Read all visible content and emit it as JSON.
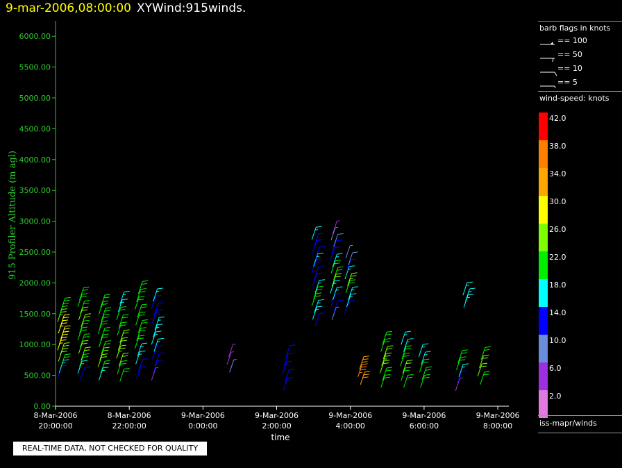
{
  "header": {
    "timestamp": "9-mar-2006,08:00:00",
    "title": "XYWind:915winds."
  },
  "quality_note": "REAL-TIME DATA, NOT CHECKED FOR QUALITY",
  "legend": {
    "barb_title": "barb flags in knots",
    "barb_flags": [
      {
        "kind": "pennant",
        "label": "== 100"
      },
      {
        "kind": "pennant-small",
        "label": "== 50"
      },
      {
        "kind": "full",
        "label": "== 10"
      },
      {
        "kind": "half",
        "label": "== 5"
      }
    ],
    "speed_title": "wind-speed: knots",
    "colorbar": [
      {
        "label": "42.0",
        "color": "#ff0000"
      },
      {
        "label": "38.0",
        "color": "#ff7f00"
      },
      {
        "label": "34.0",
        "color": "#ffa500"
      },
      {
        "label": "30.0",
        "color": "#ffff00"
      },
      {
        "label": "26.0",
        "color": "#7fff00"
      },
      {
        "label": "22.0",
        "color": "#00ee00"
      },
      {
        "label": "18.0",
        "color": "#00ffff"
      },
      {
        "label": "14.0",
        "color": "#0000ff"
      },
      {
        "label": "10.0",
        "color": "#6a8ddb"
      },
      {
        "label": "6.0",
        "color": "#9b30e0"
      },
      {
        "label": "2.0",
        "color": "#e07ae0"
      }
    ],
    "source": "iss-mapr/winds"
  },
  "chart_data": {
    "type": "scatter",
    "title": "XYWind:915winds.",
    "xlabel": "time",
    "ylabel": "915 Profiler Altitude (m agl)",
    "xlim": [
      20,
      32.3
    ],
    "ylim": [
      0,
      6250
    ],
    "x_ticks": [
      {
        "value": 20,
        "line1": "8-Mar-2006",
        "line2": "20:00:00"
      },
      {
        "value": 22,
        "line1": "8-Mar-2006",
        "line2": "22:00:00"
      },
      {
        "value": 24,
        "line1": "9-Mar-2006",
        "line2": "0:00:00"
      },
      {
        "value": 26,
        "line1": "9-Mar-2006",
        "line2": "2:00:00"
      },
      {
        "value": 28,
        "line1": "9-Mar-2006",
        "line2": "4:00:00"
      },
      {
        "value": 30,
        "line1": "9-Mar-2006",
        "line2": "6:00:00"
      },
      {
        "value": 32,
        "line1": "9-Mar-2006",
        "line2": "8:00:00"
      }
    ],
    "y_ticks": [
      0,
      500,
      1000,
      1500,
      2000,
      2500,
      3000,
      3500,
      4000,
      4500,
      5000,
      5500,
      6000
    ],
    "y_tick_labels": [
      "0.00",
      "500.00",
      "1000.00",
      "1500.00",
      "2000.00",
      "2500.00",
      "3000.00",
      "3500.00",
      "4000.00",
      "4500.00",
      "5000.00",
      "5500.00",
      "6000.00"
    ],
    "grid": false,
    "profiles": [
      {
        "time": 20.1,
        "bottom": 450,
        "top": 1550,
        "speeds": [
          14,
          16,
          20,
          24,
          26,
          28,
          30,
          30,
          29,
          28,
          26,
          22,
          20
        ]
      },
      {
        "time": 20.65,
        "bottom": 420,
        "top": 1720,
        "speeds": [
          14,
          18,
          22,
          24,
          24,
          23,
          22,
          22,
          24,
          24,
          22,
          21,
          20
        ]
      },
      {
        "time": 21.2,
        "bottom": 420,
        "top": 1600,
        "speeds": [
          18,
          20,
          24,
          24,
          23,
          22,
          22,
          22,
          22,
          21,
          20,
          20
        ]
      },
      {
        "time": 21.7,
        "bottom": 400,
        "top": 1650,
        "speeds": [
          20,
          22,
          24,
          25,
          24,
          24,
          22,
          22,
          20,
          18,
          17
        ]
      },
      {
        "time": 22.2,
        "bottom": 430,
        "top": 1820,
        "speeds": [
          14,
          14,
          16,
          18,
          20,
          22,
          22,
          22,
          22,
          21,
          20,
          22
        ]
      },
      {
        "time": 22.65,
        "bottom": 420,
        "top": 1700,
        "speeds": [
          6,
          13,
          14,
          14,
          16,
          18,
          18,
          16,
          15,
          14,
          14,
          17
        ]
      },
      {
        "time": 24.7,
        "bottom": 550,
        "top": 800,
        "speeds": [
          8,
          7,
          6
        ]
      },
      {
        "time": 26.2,
        "bottom": 250,
        "top": 780,
        "speeds": [
          14,
          14,
          15,
          13,
          12
        ]
      },
      {
        "time": 27.0,
        "bottom": 1300,
        "top": 2700,
        "speeds": [
          14,
          16,
          18,
          20,
          22,
          16,
          14,
          13,
          15,
          17,
          14,
          13,
          14,
          16
        ]
      },
      {
        "time": 27.5,
        "bottom": 1400,
        "top": 2800,
        "speeds": [
          9,
          12,
          14,
          16,
          18,
          24,
          22,
          20,
          16,
          14,
          12,
          10,
          8,
          7
        ]
      },
      {
        "time": 27.9,
        "bottom": 1500,
        "top": 2400,
        "speeds": [
          14,
          16,
          18,
          22,
          26,
          18,
          14,
          10,
          8
        ]
      },
      {
        "time": 28.25,
        "bottom": 350,
        "top": 600,
        "speeds": [
          34,
          36,
          32
        ]
      },
      {
        "time": 28.85,
        "bottom": 300,
        "top": 1000,
        "speeds": [
          22,
          22,
          24,
          25,
          24,
          22,
          20
        ]
      },
      {
        "time": 29.4,
        "bottom": 300,
        "top": 1000,
        "speeds": [
          22,
          22,
          24,
          22,
          20,
          18,
          16
        ]
      },
      {
        "time": 29.9,
        "bottom": 300,
        "top": 800,
        "speeds": [
          22,
          22,
          20,
          18,
          18
        ]
      },
      {
        "time": 30.9,
        "bottom": 250,
        "top": 700,
        "speeds": [
          6,
          14,
          18,
          22,
          20
        ]
      },
      {
        "time": 31.5,
        "bottom": 350,
        "top": 750,
        "speeds": [
          22,
          24,
          24,
          22
        ]
      },
      {
        "time": 31.1,
        "bottom": 1600,
        "top": 1800,
        "speeds": [
          18,
          17,
          16
        ]
      }
    ]
  }
}
